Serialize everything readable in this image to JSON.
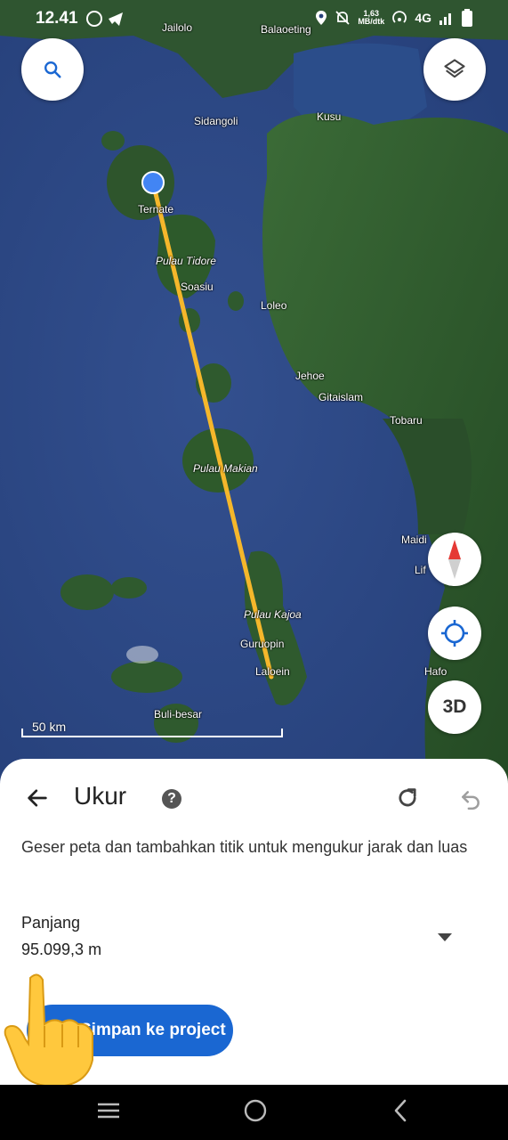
{
  "status_bar": {
    "time": "12.41",
    "speed_value": "1,63",
    "speed_unit": "MB/dtk",
    "network": "4G"
  },
  "map": {
    "labels": {
      "jailolo": "Jailolo",
      "balaoeting": "Balaoeting",
      "sidangoli": "Sidangoli",
      "kusu": "Kusu",
      "ternate": "Ternate",
      "pulau_tidore": "Pulau Tidore",
      "soasiu": "Soasiu",
      "loleo": "Loleo",
      "jehoe": "Jehoe",
      "gitaislam": "Gitaislam",
      "tobaru": "Tobaru",
      "pulau_makian": "Pulau Makian",
      "maidi": "Maidi",
      "lif": "Lif",
      "pulau_kajoa": "Pulau Kajoa",
      "guruopin": "Guruopin",
      "laloein": "Laloein",
      "hafo": "Hafo",
      "buli_besar": "Buli-besar"
    },
    "scale_label": "50 km",
    "button_3d": "3D",
    "icons": [
      "search-icon",
      "layers-icon",
      "compass-icon",
      "my-location-icon"
    ],
    "measure_line_color": "#f5b72b"
  },
  "sheet": {
    "title": "Ukur",
    "help_icon_glyph": "?",
    "description": "Geser peta dan tambahkan titik untuk mengukur jarak dan luas",
    "length_label": "Panjang",
    "length_value": "95.099,3 m",
    "save_button": "Simpan ke project"
  },
  "colors": {
    "accent": "#1a67d2",
    "sea": "#2f4a8a",
    "land": "#2e5a2c"
  }
}
